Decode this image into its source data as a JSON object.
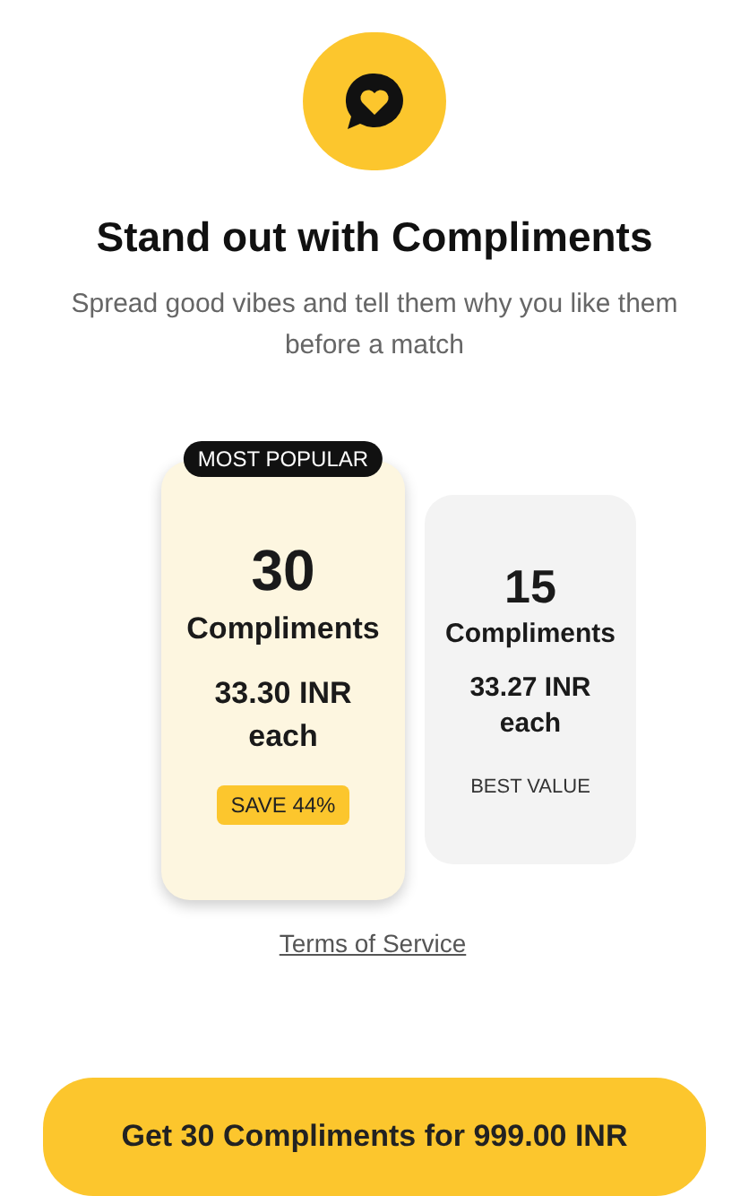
{
  "title": "Stand out with Compliments",
  "subtitle": "Spread good vibes and tell them why you like them before a match",
  "plans": [
    {
      "selected": true,
      "ribbon": "MOST POPULAR",
      "count": "30",
      "unit": "Compliments",
      "price": "33.30 INR each",
      "tag": {
        "kind": "badge",
        "text": "SAVE 44%"
      }
    },
    {
      "selected": false,
      "count": "15",
      "unit": "Compliments",
      "price": "33.27 INR each",
      "tag": {
        "kind": "label",
        "text": "BEST VALUE"
      }
    }
  ],
  "terms_link": "Terms of Service",
  "buy_button": "Get 30 Compliments for 999.00 INR"
}
